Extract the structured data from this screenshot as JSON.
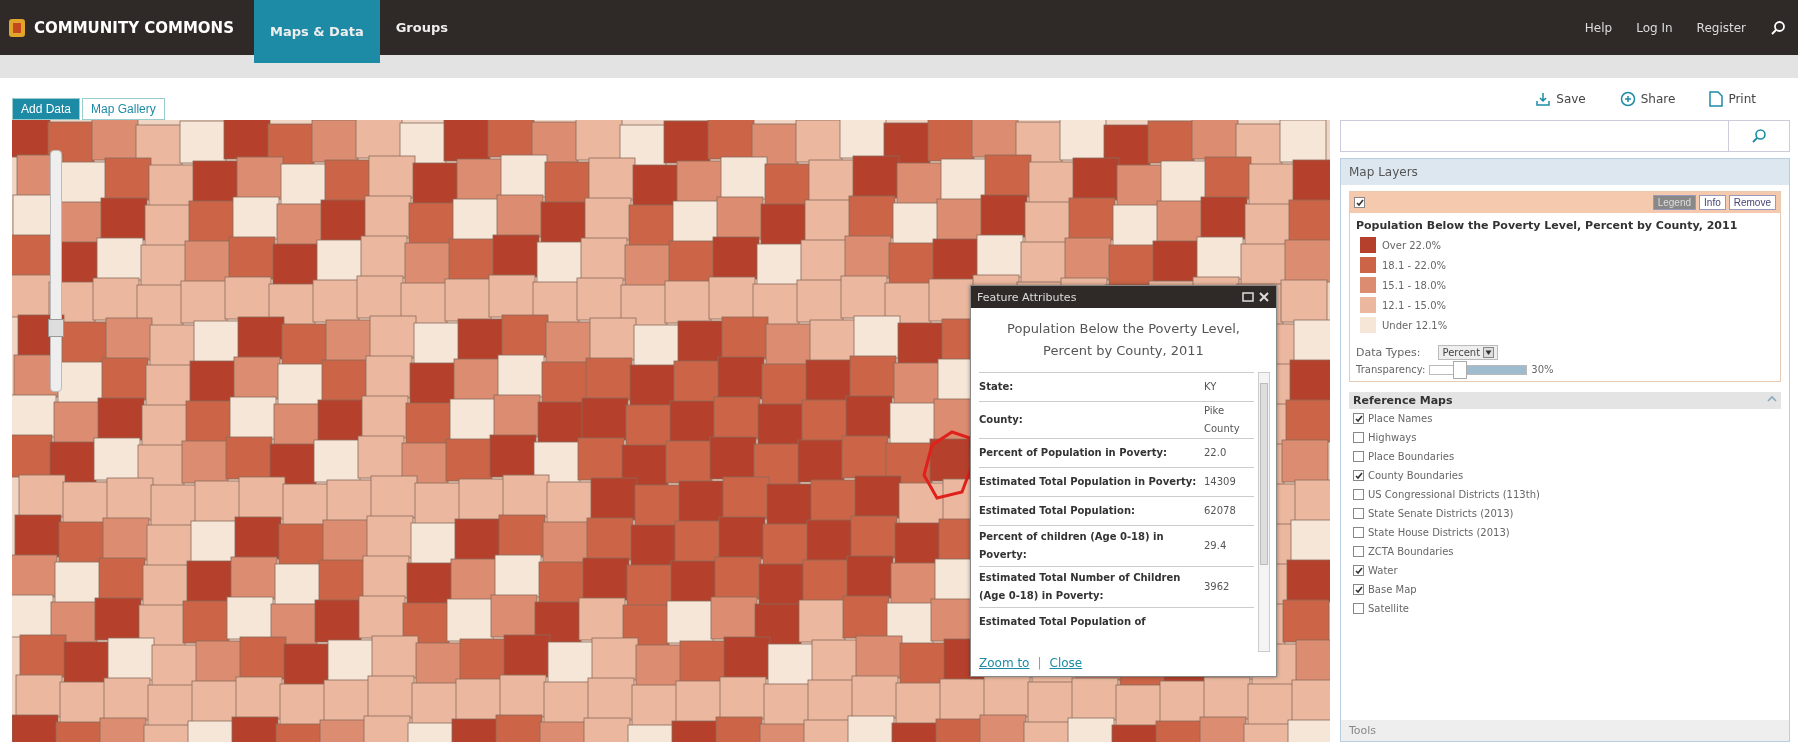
{
  "header": {
    "brand": "COMMUNITY COMMONS",
    "nav": [
      {
        "label": "Maps & Data",
        "selected": true
      },
      {
        "label": "Groups",
        "selected": false
      }
    ],
    "links": [
      "Help",
      "Log In",
      "Register"
    ]
  },
  "toolbar": {
    "tabs": [
      {
        "label": "Add Data",
        "selected": true
      },
      {
        "label": "Map Gallery",
        "selected": false
      }
    ],
    "actions": [
      {
        "kind": "save",
        "label": "Save"
      },
      {
        "kind": "share",
        "label": "Share"
      },
      {
        "kind": "print",
        "label": "Print"
      }
    ]
  },
  "popup": {
    "title": "Feature Attributes",
    "heading": "Population Below  the Poverty Level, Percent by County, 2011",
    "rows": [
      {
        "label": "State:",
        "value": "KY"
      },
      {
        "label": "County:",
        "value": "Pike County"
      },
      {
        "label": "Percent of Population in Poverty:",
        "value": "22.0"
      },
      {
        "label": "Estimated Total Population in Poverty:",
        "value": "14309"
      },
      {
        "label": "Estimated Total Population:",
        "value": "62078"
      },
      {
        "label": "Percent of children (Age 0-18) in Poverty:",
        "value": "29.4"
      },
      {
        "label": "Estimated Total Number of Children (Age 0-18) in Poverty:",
        "value": "3962"
      },
      {
        "label": "Estimated Total Population of"
      }
    ],
    "links": [
      "Zoom to",
      "Close"
    ],
    "link_separator": "|"
  },
  "map": {
    "zoom": {
      "level": 0.25
    }
  },
  "sidebar": {
    "panel_title": "Map Layers",
    "layer": {
      "visible": true,
      "buttons": [
        {
          "label": "Legend",
          "selected": true
        },
        {
          "label": "Info",
          "selected": false
        },
        {
          "label": "Remove",
          "selected": false
        }
      ],
      "title": "Population Below the Poverty Level, Percent by County, 2011",
      "legend": [
        {
          "label": "Over 22.0%",
          "color": "#b5412c"
        },
        {
          "label": "18.1 - 22.0%",
          "color": "#cc6447"
        },
        {
          "label": "15.1 - 18.0%",
          "color": "#dc8c71"
        },
        {
          "label": "12.1 - 15.0%",
          "color": "#ebb89f"
        },
        {
          "label": "Under 12.1%",
          "color": "#f6e6d8"
        }
      ],
      "data_types_label": "Data Types:",
      "data_type": "Percent",
      "transparency_label": "Transparency:",
      "transparency": {
        "level": 0.3
      },
      "transparency_reading": "30%"
    },
    "reference_title": "Reference Maps",
    "reference": [
      {
        "label": "Place Names",
        "checked": true
      },
      {
        "label": "Highways",
        "checked": false
      },
      {
        "label": "Place Boundaries",
        "checked": false
      },
      {
        "label": "County Boundaries",
        "checked": true
      },
      {
        "label": "US Congressional Districts (113th)",
        "checked": false
      },
      {
        "label": "State Senate Districts (2013)",
        "checked": false
      },
      {
        "label": "State House Districts (2013)",
        "checked": false
      },
      {
        "label": "ZCTA Boundaries",
        "checked": false
      },
      {
        "label": "Water",
        "checked": true
      },
      {
        "label": "Base Map",
        "checked": true
      },
      {
        "label": "Satellite",
        "checked": false
      }
    ],
    "tools_title": "Tools"
  }
}
